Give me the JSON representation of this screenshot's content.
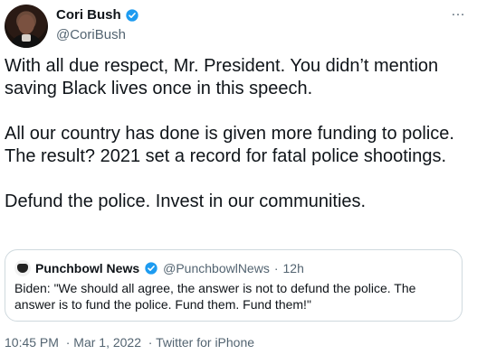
{
  "author": {
    "name": "Cori Bush",
    "handle": "@CoriBush",
    "verified": true
  },
  "menu_icon": "…",
  "tweet": {
    "paragraphs": [
      "With all due respect, Mr. President. You didn’t mention saving Black lives once in this speech.",
      "All our country has done is given more funding to police. The result? 2021 set a record for fatal police shootings.",
      "Defund the police. Invest in our communities."
    ]
  },
  "quote": {
    "name": "Punchbowl News",
    "handle": "@PunchbowlNews",
    "separator": "·",
    "time": "12h",
    "verified": true,
    "text": "Biden: \"We should all agree, the answer is not to defund the police. The answer is to fund the police. Fund them. Fund them!\""
  },
  "meta": {
    "time": "10:45 PM",
    "date": "Mar 1, 2022",
    "source": "Twitter for iPhone"
  },
  "colors": {
    "verified": "#1d9bf0",
    "secondary_text": "#536471",
    "border": "#cfd9de"
  }
}
